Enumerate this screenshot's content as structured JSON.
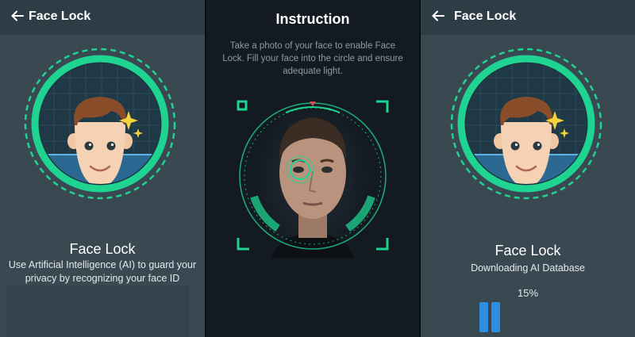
{
  "colors": {
    "accent": "#1fd391",
    "background_dark": "#141a21",
    "panel": "#3a4852",
    "progress": "#2e8fe0"
  },
  "left": {
    "appbar_title": "Face Lock",
    "back_icon": "arrow-left-icon",
    "card_title": "Face Lock",
    "card_text_line1": "Use Artificial Intelligence (AI) to guard your",
    "card_text_line2": "privacy by recognizing your face ID"
  },
  "middle": {
    "title": "Instruction",
    "text_line1": "Take a photo of your face to enable Face",
    "text_line2": "Lock. Fill your face into the circle and ensure",
    "text_line3": "adequate light."
  },
  "right": {
    "appbar_title": "Face Lock",
    "back_icon": "arrow-left-icon",
    "card_title": "Face Lock",
    "status": "Downloading AI Database",
    "progress_label": "15%",
    "progress_value": 0.15,
    "control_icon": "pause-icon"
  }
}
